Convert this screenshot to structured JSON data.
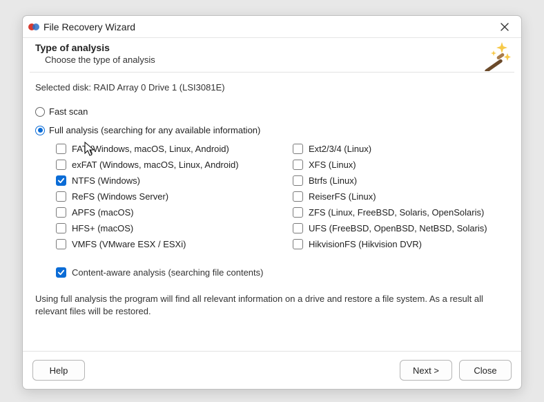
{
  "window": {
    "title": "File Recovery Wizard"
  },
  "header": {
    "title": "Type of analysis",
    "subtitle": "Choose the type of analysis"
  },
  "selected_disk": {
    "prefix": "Selected disk: ",
    "value": "RAID Array 0 Drive 1 (LSI3081E)"
  },
  "options": {
    "fast_scan": {
      "label": "Fast scan",
      "checked": false
    },
    "full_analysis": {
      "label": "Full analysis (searching for any available information)",
      "checked": true
    }
  },
  "filesystems": {
    "left": [
      {
        "id": "fat",
        "label": "FAT (Windows, macOS, Linux, Android)",
        "checked": false
      },
      {
        "id": "exfat",
        "label": "exFAT (Windows, macOS, Linux, Android)",
        "checked": false
      },
      {
        "id": "ntfs",
        "label": "NTFS (Windows)",
        "checked": true
      },
      {
        "id": "refs",
        "label": "ReFS (Windows Server)",
        "checked": false
      },
      {
        "id": "apfs",
        "label": "APFS (macOS)",
        "checked": false
      },
      {
        "id": "hfsp",
        "label": "HFS+ (macOS)",
        "checked": false
      },
      {
        "id": "vmfs",
        "label": "VMFS (VMware ESX / ESXi)",
        "checked": false
      }
    ],
    "right": [
      {
        "id": "ext",
        "label": "Ext2/3/4 (Linux)",
        "checked": false
      },
      {
        "id": "xfs",
        "label": "XFS (Linux)",
        "checked": false
      },
      {
        "id": "btrfs",
        "label": "Btrfs (Linux)",
        "checked": false
      },
      {
        "id": "reiser",
        "label": "ReiserFS (Linux)",
        "checked": false
      },
      {
        "id": "zfs",
        "label": "ZFS (Linux, FreeBSD, Solaris, OpenSolaris)",
        "checked": false
      },
      {
        "id": "ufs",
        "label": "UFS (FreeBSD, OpenBSD, NetBSD, Solaris)",
        "checked": false
      },
      {
        "id": "hikfs",
        "label": "HikvisionFS (Hikvision DVR)",
        "checked": false
      }
    ]
  },
  "content_aware": {
    "label": "Content-aware analysis (searching file contents)",
    "checked": true
  },
  "description": "Using full analysis the program will find all relevant information on a drive and restore a file system. As a result all relevant files will be restored.",
  "buttons": {
    "help": "Help",
    "next": "Next >",
    "close": "Close"
  }
}
